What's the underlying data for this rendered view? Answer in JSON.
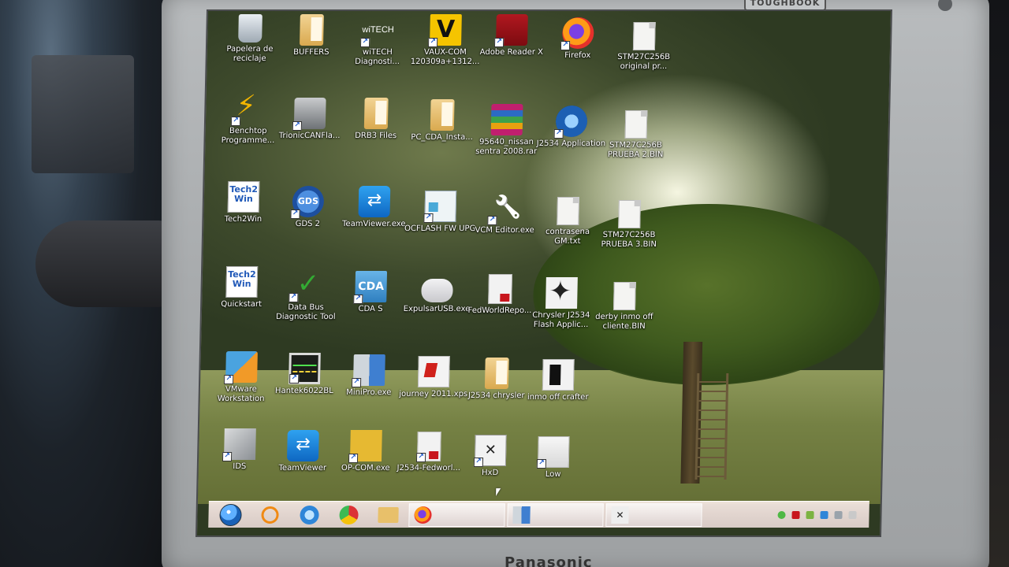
{
  "hardware": {
    "brand_top": "TOUGHBOOK",
    "brand_bottom": "Panasonic"
  },
  "desktop": {
    "icons": [
      {
        "id": "papelera",
        "label": "Papelera de reciclaje",
        "icon": "recycle-bin-icon"
      },
      {
        "id": "buffers",
        "label": "BUFFERS",
        "icon": "folder-icon"
      },
      {
        "id": "witech",
        "label": "wiTECH Diagnosti...",
        "icon": "witech-icon"
      },
      {
        "id": "vaux",
        "label": "VAUX-COM 120309a+1312...",
        "icon": "vaux-com-icon"
      },
      {
        "id": "adobe",
        "label": "Adobe Reader X",
        "icon": "adobe-reader-icon"
      },
      {
        "id": "firefox",
        "label": "Firefox",
        "icon": "firefox-icon"
      },
      {
        "id": "stm1",
        "label": "STM27C256B original pr...",
        "icon": "file-icon"
      },
      {
        "id": "benchtop",
        "label": "Benchtop Programme...",
        "icon": "lightning-icon"
      },
      {
        "id": "trionic",
        "label": "TrionicCANFla...",
        "icon": "trionic-icon"
      },
      {
        "id": "drb3",
        "label": "DRB3 Files",
        "icon": "folder-icon"
      },
      {
        "id": "pccda",
        "label": "PC_CDA_Insta...",
        "icon": "folder-icon"
      },
      {
        "id": "nissan",
        "label": "95640_nissan sentra 2008.rar",
        "icon": "winrar-icon"
      },
      {
        "id": "j2534app",
        "label": "J2534 Application",
        "icon": "j2534-icon"
      },
      {
        "id": "stm2",
        "label": "STM27C256B PRUEBA 2.BIN",
        "icon": "file-icon"
      },
      {
        "id": "tech2win",
        "label": "Tech2Win",
        "icon": "tech2win-icon"
      },
      {
        "id": "gds2",
        "label": "GDS 2",
        "icon": "gds-icon"
      },
      {
        "id": "teamviewerexe",
        "label": "TeamViewer.exe",
        "icon": "teamviewer-icon"
      },
      {
        "id": "ocflash",
        "label": "OCFLASH FW UPG",
        "icon": "ocflash-icon"
      },
      {
        "id": "vcm",
        "label": "VCM Editor.exe",
        "icon": "wrench-icon"
      },
      {
        "id": "contrasena",
        "label": "contrasena GM.txt",
        "icon": "file-icon"
      },
      {
        "id": "stm3",
        "label": "STM27C256B PRUEBA 3.BIN",
        "icon": "file-icon"
      },
      {
        "id": "quickstart",
        "label": "Quickstart",
        "icon": "tech2win-icon"
      },
      {
        "id": "databus",
        "label": "Data Bus Diagnostic Tool",
        "icon": "databus-icon"
      },
      {
        "id": "cdas",
        "label": "CDA S",
        "icon": "cda-icon"
      },
      {
        "id": "expulsar",
        "label": "ExpulsarUSB.exe",
        "icon": "usb-icon"
      },
      {
        "id": "fedworld",
        "label": "FedWorldRepo...",
        "icon": "pdf-icon"
      },
      {
        "id": "chryslerj2534",
        "label": "Chrysler J2534 Flash Applic...",
        "icon": "chrysler-icon"
      },
      {
        "id": "derby",
        "label": "derby inmo off cliente.BIN",
        "icon": "file-icon"
      },
      {
        "id": "vmware",
        "label": "VMware Workstation",
        "icon": "vmware-icon"
      },
      {
        "id": "hantek",
        "label": "Hantek6022BL",
        "icon": "hantek-icon"
      },
      {
        "id": "minipro",
        "label": "MiniPro.exe",
        "icon": "minipro-icon"
      },
      {
        "id": "journey",
        "label": "journey 2011.xps",
        "icon": "xps-icon"
      },
      {
        "id": "j2534chrysler",
        "label": "J2534 chrysler",
        "icon": "folder-icon"
      },
      {
        "id": "inmocrafter",
        "label": "inmo off crafter",
        "icon": "crafter-icon"
      },
      {
        "id": "ids",
        "label": "IDS",
        "icon": "ids-icon"
      },
      {
        "id": "teamviewer",
        "label": "TeamViewer",
        "icon": "teamviewer-icon"
      },
      {
        "id": "opcom",
        "label": "OP-COM.exe",
        "icon": "opcom-icon"
      },
      {
        "id": "j2534fed",
        "label": "J2534-Fedworl...",
        "icon": "pdf-icon"
      },
      {
        "id": "hxd",
        "label": "HxD",
        "icon": "hxd-icon"
      },
      {
        "id": "low",
        "label": "Low",
        "icon": "file-icon"
      }
    ]
  },
  "taskbar": {
    "pinned": [
      "start-icon",
      "media-player-icon",
      "internet-explorer-icon",
      "chrome-icon",
      "folder-icon"
    ],
    "tasks": [
      {
        "icon": "firefox-icon",
        "label": ""
      },
      {
        "icon": "minipro-icon",
        "label": ""
      },
      {
        "icon": "hxd-icon",
        "label": ""
      }
    ],
    "clock": {
      "time": "",
      "date": ""
    }
  },
  "colors": {
    "taskbar": "#f0e2dc",
    "label_text": "#ffffff",
    "bezel": "#abaeb0"
  }
}
